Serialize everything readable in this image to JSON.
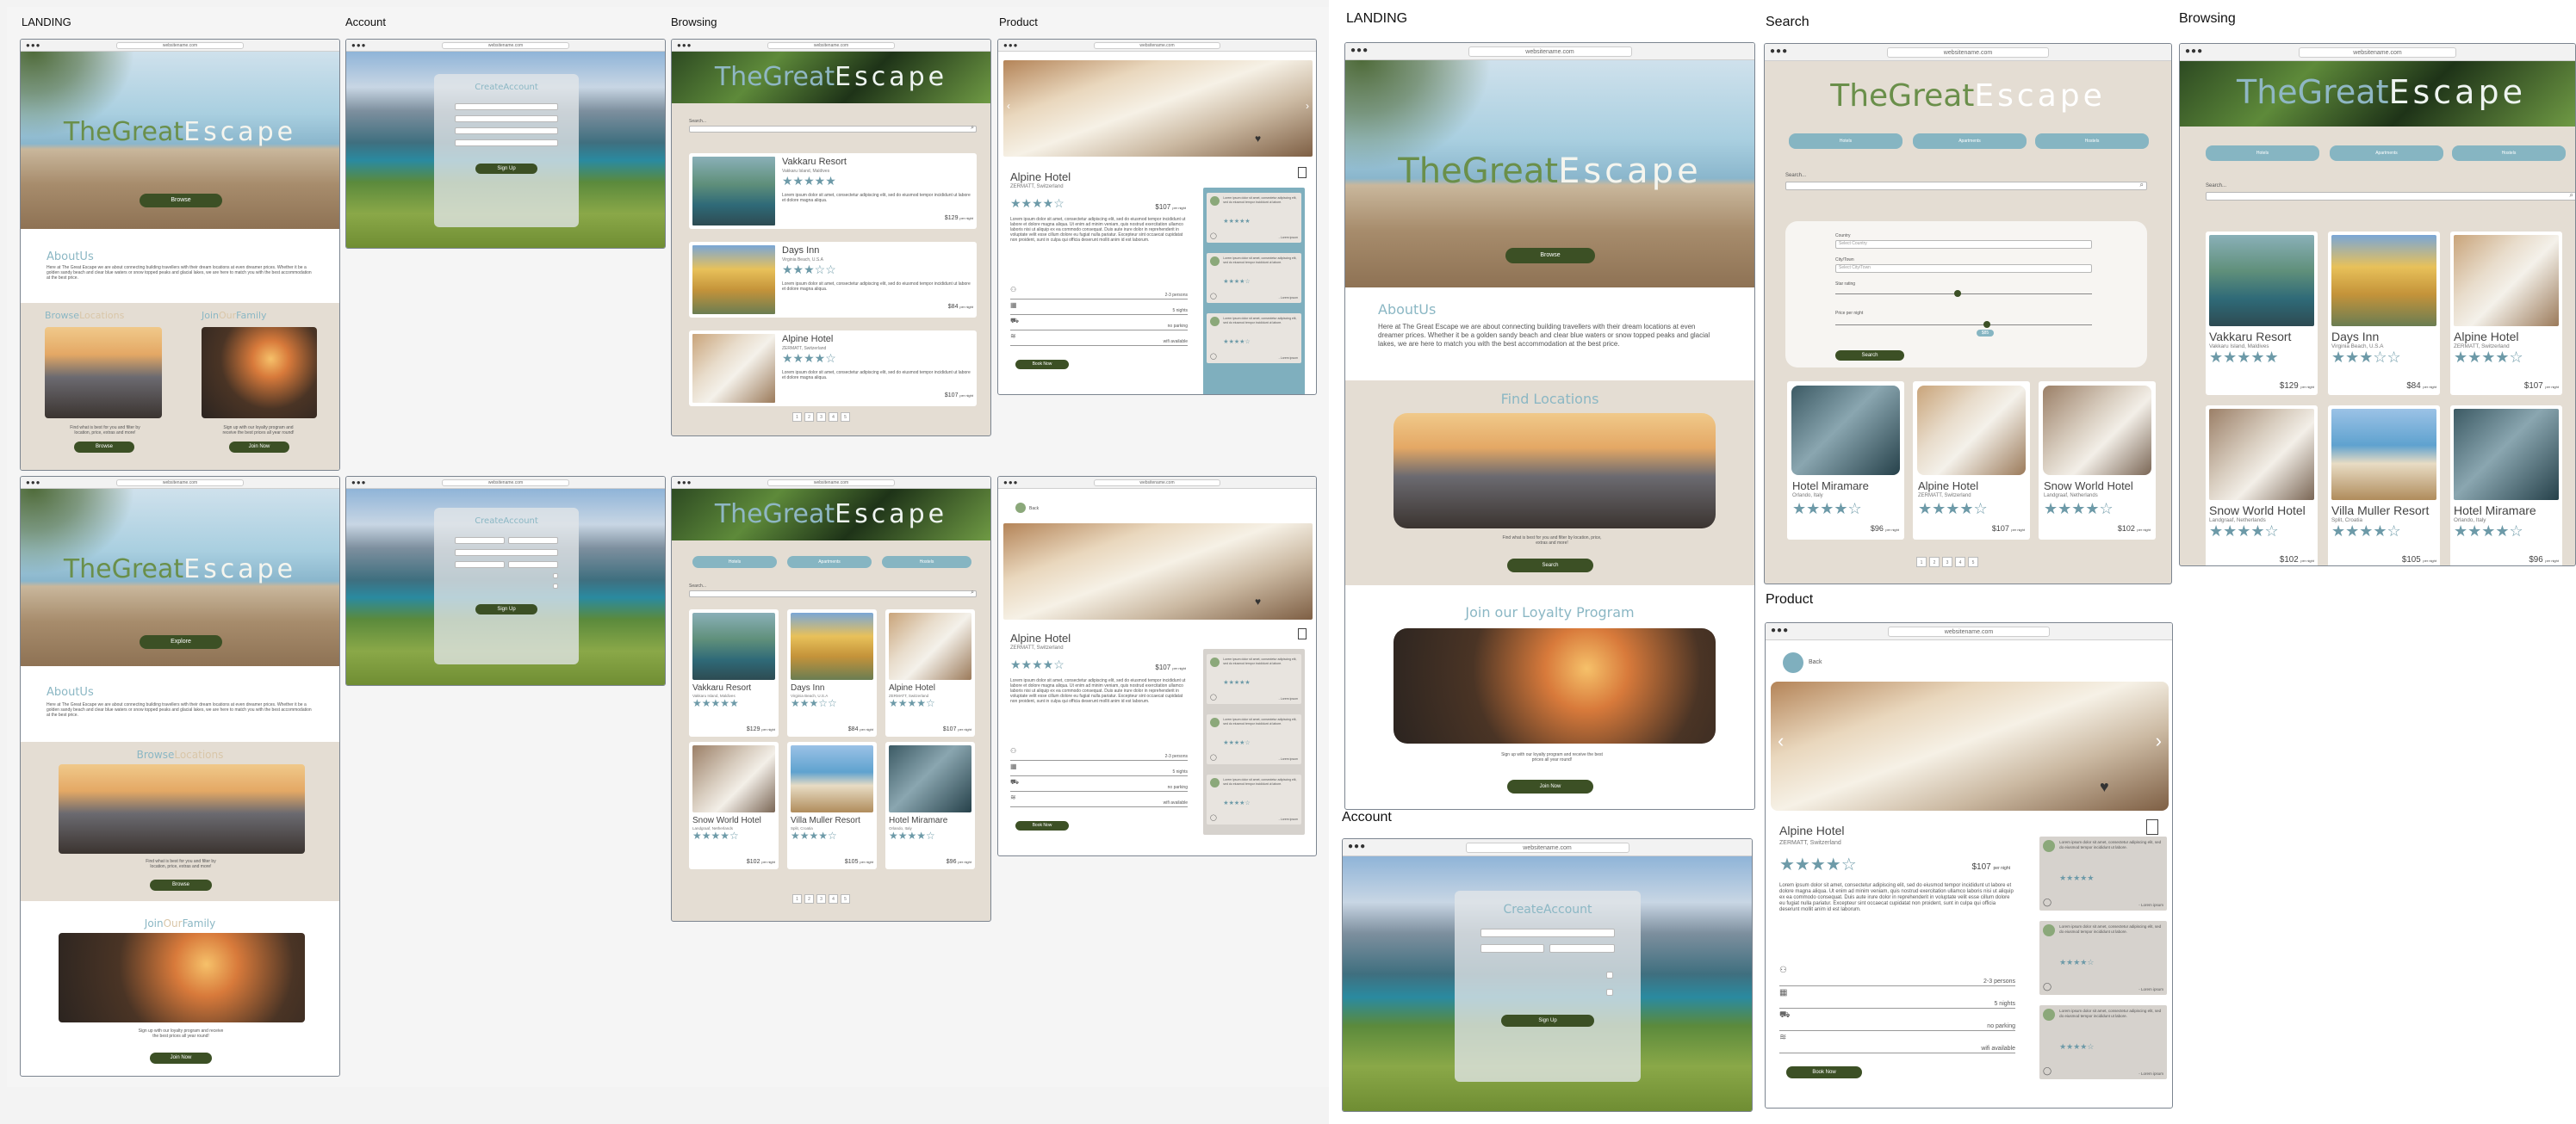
{
  "labels": {
    "landing": "LANDING",
    "account": "Account",
    "browsing": "Browsing",
    "product": "Product",
    "landing2": "LANDING",
    "search": "Search",
    "browsing2": "Browsing",
    "product2": "Product",
    "account2": "Account"
  },
  "browser": {
    "url": "websitename.com",
    "dots": "●●●"
  },
  "brand": {
    "great": "TheGreat",
    "escape": "Escape"
  },
  "landing": {
    "browse_btn": "Browse",
    "explore_btn": "Explore",
    "about_title": "AboutUs",
    "about_text": "Here at The Great Escape we are about connecting building travellers with their dream locations at even dreamer prices. Whether it be a golden sandy beach and clear blue waters or snow topped peaks and glacial lakes, we are here to match you with the best accommodation at the best price.",
    "browse_locations_a": "Browse",
    "browse_locations_b": "Locations",
    "join_a": "Join",
    "join_b": "Our",
    "join_c": "Family",
    "find_text": "Find what is best for you and filter by location, price, extras and more!",
    "signup_text": "Sign up with our loyalty program and receive the best prices all year round!",
    "join_btn": "Join Now",
    "find_locations": "Find Locations",
    "search_btn": "Search",
    "loyalty": "Join our Loyalty Program"
  },
  "account": {
    "title": "CreateAccount",
    "signup_btn": "Sign Up"
  },
  "browsing": {
    "search_placeholder": "Search...",
    "tabs": [
      "Hotels",
      "Apartments",
      "Hostels"
    ],
    "pages": [
      "1",
      "2",
      "3",
      "4",
      "5"
    ],
    "listings": [
      {
        "name": "Vakkaru Resort",
        "loc": "Vakkaru Island, Maldives",
        "stars": "★★★★★",
        "price": "$129",
        "per": "per night"
      },
      {
        "name": "Days Inn",
        "loc": "Virginia Beach, U.S.A",
        "stars": "★★★☆☆",
        "price": "$84",
        "per": "per night"
      },
      {
        "name": "Alpine Hotel",
        "loc": "ZERMATT, Switzerland",
        "stars": "★★★★☆",
        "price": "$107",
        "per": "per night"
      },
      {
        "name": "Snow World Hotel",
        "loc": "Landgraaf, Netherlands",
        "stars": "★★★★☆",
        "price": "$102",
        "per": "per night"
      },
      {
        "name": "Villa Muller Resort",
        "loc": "Split, Croatia",
        "stars": "★★★★☆",
        "price": "$105",
        "per": "per night"
      },
      {
        "name": "Hotel Miramare",
        "loc": "Orlando, Italy",
        "stars": "★★★★☆",
        "price": "$96",
        "per": "per night"
      }
    ],
    "lorem": "Lorem ipsum dolor sit amet, consectetur adipiscing elit, sed do eiusmod tempor incididunt ut labore et dolore magna aliqua."
  },
  "search": {
    "search_label": "Search...",
    "filter1": "Country",
    "filter1_value": "Select Country",
    "filter2": "City/Town",
    "filter2_value": "Select City/Town",
    "filter3": "Star rating",
    "filter4": "Price per night",
    "price_value": "$85",
    "search_btn": "Search",
    "results": [
      {
        "name": "Hotel Miramare",
        "loc": "Orlando, Italy",
        "stars": "★★★★☆",
        "price": "$96",
        "per": "per night"
      },
      {
        "name": "Alpine Hotel",
        "loc": "ZERMATT, Switzerland",
        "stars": "★★★★☆",
        "price": "$107",
        "per": "per night"
      },
      {
        "name": "Snow World Hotel",
        "loc": "Landgraaf, Netherlands",
        "stars": "★★★★☆",
        "price": "$102",
        "per": "per night"
      }
    ]
  },
  "product": {
    "back": "Back",
    "name": "Alpine Hotel",
    "loc": "ZERMATT, Switzerland",
    "stars": "★★★★☆",
    "price": "$107",
    "per": "per night",
    "desc": "Lorem ipsum dolor sit amet, consectetur adipiscing elit, sed do eiusmod tempor incididunt ut labore et dolore magna aliqua. Ut enim ad minim veniam, quis nostrud exercitation ullamco laboris nisi ut aliquip ex ea commodo consequat. Duis aute irure dolor in reprehenderit in voluptate velit esse cillum dolore eu fugiat nulla pariatur. Excepteur sint occaecat cupidatat non proident, sunt in culpa qui officia deserunt mollit anim id est laborum.",
    "amenities": [
      "2-3 persons",
      "5 nights",
      "no parking",
      "wifi available"
    ],
    "book_btn": "Book Now",
    "review_text": "Lorem ipsum dolor sit amet, consectetur adipiscing elit, sed do eiusmod tempor incididunt ut labore.",
    "review_stars": [
      "★★★★★",
      "★★★★☆",
      "★★★★☆"
    ],
    "review_author": [
      "- Lorem ipsum",
      "- Lorem ipsum",
      "- Lorem ipsum"
    ]
  },
  "colors": {
    "accent_green": "#3c5025",
    "accent_teal": "#86b5c2",
    "beige": "#e4ddd3",
    "star": "#6d9aa8"
  }
}
